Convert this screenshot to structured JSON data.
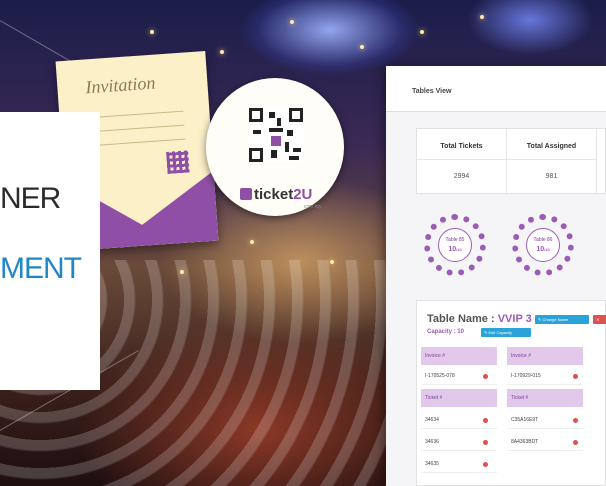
{
  "promo": {
    "invitation_title": "Invitation",
    "headline_line1": "NER",
    "headline_line2": "MENT",
    "brand_name_a": "ticket",
    "brand_name_b": "2U",
    "brand_domain": "com.my"
  },
  "tables_view": {
    "header_title": "Tables View",
    "stats": [
      {
        "label": "Total Tickets",
        "value": "2994"
      },
      {
        "label": "Total Assigned",
        "value": "981"
      }
    ],
    "round_tables": [
      {
        "name": "Table 85",
        "count": "10",
        "capacity": "/10"
      },
      {
        "name": "Table 86",
        "count": "10",
        "capacity": "/10"
      }
    ],
    "detail": {
      "table_name_label": "Table Name :",
      "table_name_value": "VVIP 3",
      "change_name_label": "Change Name",
      "capacity_label": "Capacity : 10",
      "edit_capacity_label": "Edit Capacity",
      "columns": [
        {
          "invoice_header": "Invoice #",
          "invoice": "I-170525-078",
          "ticket_header": "Ticket #",
          "tickets": [
            "34634",
            "34636",
            "34635"
          ]
        },
        {
          "invoice_header": "Invoice #",
          "invoice": "I-170929-015",
          "ticket_header": "Ticket #",
          "tickets": [
            "C35A16E9T",
            "8A4363BDT"
          ]
        }
      ]
    },
    "colors": {
      "accent": "#9b5cb4",
      "button_blue": "#2aa3d8",
      "button_red": "#e05050"
    }
  }
}
